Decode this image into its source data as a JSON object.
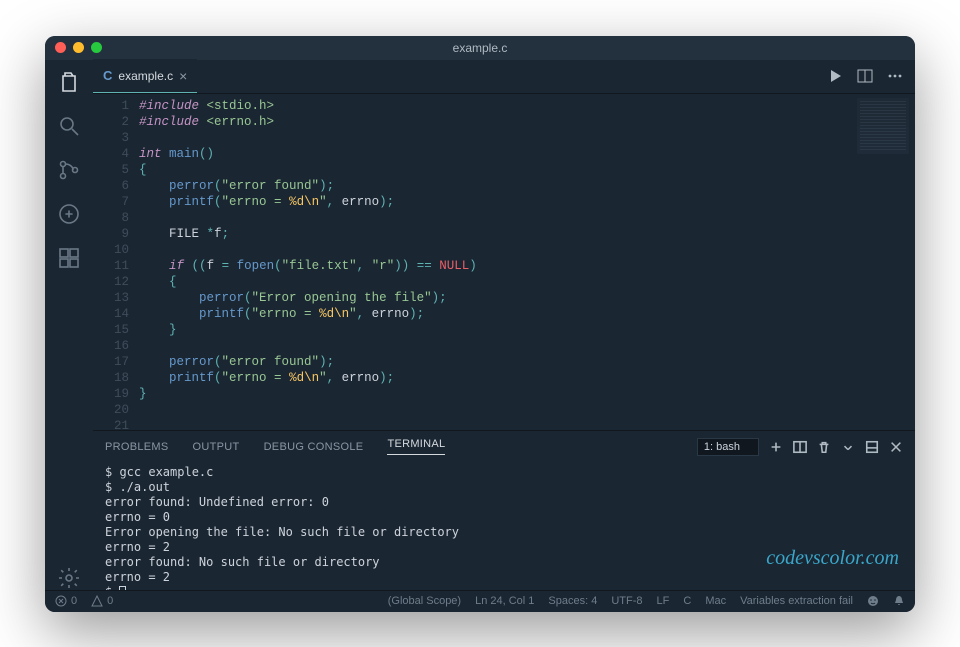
{
  "window": {
    "title": "example.c"
  },
  "tab": {
    "icon_letter": "C",
    "filename": "example.c"
  },
  "editor": {
    "lines": [
      {
        "n": 1,
        "html": "<span class='c-pre'>#include</span> <span class='c-str'>&lt;stdio.h&gt;</span>"
      },
      {
        "n": 2,
        "html": "<span class='c-pre'>#include</span> <span class='c-str'>&lt;errno.h&gt;</span>"
      },
      {
        "n": 3,
        "html": ""
      },
      {
        "n": 4,
        "html": "<span class='c-ty'>int</span> <span class='c-fn'>main</span><span class='c-op'>()</span>"
      },
      {
        "n": 5,
        "html": "<span class='c-op'>{</span>"
      },
      {
        "n": 6,
        "html": "    <span class='c-fn'>perror</span><span class='c-op'>(</span><span class='c-str'>\"error found\"</span><span class='c-op'>);</span>"
      },
      {
        "n": 7,
        "html": "    <span class='c-fn'>printf</span><span class='c-op'>(</span><span class='c-str'>\"errno = <span class='c-esc'>%d\\n</span>\"</span><span class='c-op'>,</span> errno<span class='c-op'>);</span>"
      },
      {
        "n": 8,
        "html": ""
      },
      {
        "n": 9,
        "html": "    <span class='c-id'>FILE</span> <span class='c-op'>*</span>f<span class='c-op'>;</span>"
      },
      {
        "n": 10,
        "html": ""
      },
      {
        "n": 11,
        "html": "    <span class='c-kw'>if</span> <span class='c-op'>((</span>f <span class='c-op'>=</span> <span class='c-fn'>fopen</span><span class='c-op'>(</span><span class='c-str'>\"file.txt\"</span><span class='c-op'>,</span> <span class='c-str'>\"r\"</span><span class='c-op'>))</span> <span class='c-op'>==</span> <span class='c-const'>NULL</span><span class='c-op'>)</span>"
      },
      {
        "n": 12,
        "html": "    <span class='c-op'>{</span>"
      },
      {
        "n": 13,
        "html": "        <span class='c-fn'>perror</span><span class='c-op'>(</span><span class='c-str'>\"Error opening the file\"</span><span class='c-op'>);</span>"
      },
      {
        "n": 14,
        "html": "        <span class='c-fn'>printf</span><span class='c-op'>(</span><span class='c-str'>\"errno = <span class='c-esc'>%d\\n</span>\"</span><span class='c-op'>,</span> errno<span class='c-op'>);</span>"
      },
      {
        "n": 15,
        "html": "    <span class='c-op'>}</span>"
      },
      {
        "n": 16,
        "html": ""
      },
      {
        "n": 17,
        "html": "    <span class='c-fn'>perror</span><span class='c-op'>(</span><span class='c-str'>\"error found\"</span><span class='c-op'>);</span>"
      },
      {
        "n": 18,
        "html": "    <span class='c-fn'>printf</span><span class='c-op'>(</span><span class='c-str'>\"errno = <span class='c-esc'>%d\\n</span>\"</span><span class='c-op'>,</span> errno<span class='c-op'>);</span>"
      },
      {
        "n": 19,
        "html": "<span class='c-op'>}</span>"
      },
      {
        "n": 20,
        "html": ""
      },
      {
        "n": 21,
        "html": ""
      }
    ]
  },
  "panel": {
    "tabs": {
      "problems": "PROBLEMS",
      "output": "OUTPUT",
      "debug": "DEBUG CONSOLE",
      "terminal": "TERMINAL"
    },
    "term_select": "1: bash"
  },
  "terminal": {
    "lines": [
      "$ gcc example.c",
      "$ ./a.out",
      "error found: Undefined error: 0",
      "errno = 0",
      "Error opening the file: No such file or directory",
      "errno = 2",
      "error found: No such file or directory",
      "errno = 2"
    ],
    "prompt": "$ "
  },
  "status": {
    "errors": "0",
    "warnings": "0",
    "scope": "(Global Scope)",
    "position": "Ln 24, Col 1",
    "spaces": "Spaces: 4",
    "encoding": "UTF-8",
    "eol": "LF",
    "lang": "C",
    "os": "Mac",
    "msg": "Variables extraction fail"
  },
  "watermark": "codevscolor.com"
}
